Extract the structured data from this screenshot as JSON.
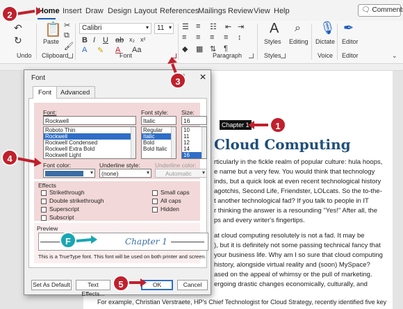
{
  "menu": {
    "tabs": [
      "Home",
      "Insert",
      "Draw",
      "Design",
      "Layout",
      "References",
      "Mailings",
      "Review",
      "View",
      "Help"
    ],
    "comments_label": "Comments"
  },
  "ribbon": {
    "groups": {
      "undo": "Undo",
      "clipboard": "Clipboard",
      "font": "Font",
      "paragraph": "Paragraph",
      "styles": "Styles",
      "voice": "Voice",
      "editor": "Editor"
    },
    "font_name": "Calibri",
    "font_size": "11",
    "paste_label": "Paste",
    "styles_label": "Styles",
    "editing_label": "Editing",
    "dictate_label": "Dictate",
    "editor_label": "Editor"
  },
  "dialog": {
    "title": "Font",
    "help": "?",
    "close": "✕",
    "tabs": [
      "Font",
      "Advanced"
    ],
    "font_label": "Font:",
    "font_value": "Rockwell",
    "font_list": [
      "Roboto Thin",
      "Rockwell",
      "Rockwell Condensed",
      "Rockwell Extra Bold",
      "Rockwell Light"
    ],
    "font_selected_index": 1,
    "style_label": "Font style:",
    "style_value": "Italic",
    "style_list": [
      "Regular",
      "Italic",
      "Bold",
      "Bold Italic"
    ],
    "style_selected_index": 1,
    "size_label": "Size:",
    "size_value": "16",
    "size_list": [
      "10",
      "11",
      "12",
      "14",
      "16"
    ],
    "size_selected_index": 4,
    "font_color_label": "Font color:",
    "font_color_value": "#3a6ea5",
    "underline_style_label": "Underline style:",
    "underline_style_value": "(none)",
    "underline_color_label": "Underline color:",
    "underline_color_value": "Automatic",
    "effects_label": "Effects",
    "effects_left": [
      "Strikethrough",
      "Double strikethrough",
      "Superscript",
      "Subscript"
    ],
    "effects_right": [
      "Small caps",
      "All caps",
      "Hidden"
    ],
    "preview_label": "Preview",
    "preview_text": "Chapter 1",
    "preview_note": "This is a TrueType font. This font will be used on both printer and screen.",
    "buttons": {
      "set_default": "Set As Default",
      "text_effects": "Text Effects...",
      "ok": "OK",
      "cancel": "Cancel"
    }
  },
  "document": {
    "chapter_label": "Chapter 1",
    "heading": "Cloud Computing",
    "lines": [
      "rticularly in the fickle realm of popular culture: hula hoops,",
      "e name but a very few. You would think that technology",
      "inds, but a quick look at even recent technological history",
      "agotchis, Second Life, Friendster, LOLcats. So the to-the-",
      "t another technological fad? If you talk to people in IT",
      "r thinking the answer is a resounding \"Yes!\" After all, the",
      "ps and every writer's fingertips.",
      "at cloud computing resolutely is not a fad. It may be",
      "), but it is definitely not some passing technical fancy that",
      "your business life. Why am I so sure that cloud computing",
      "history, alongside virtual reality and (soon) MySpace?",
      "ased on the appeal of whimsy or the pull of marketing.",
      "ergoing drastic changes economically, culturally, and"
    ],
    "last_line": "For example, Christian Verstraete, HP's Chief Technologist for Cloud Strategy, recently identified five key"
  },
  "callouts": [
    "1",
    "2",
    "3",
    "4",
    "5",
    "F"
  ]
}
